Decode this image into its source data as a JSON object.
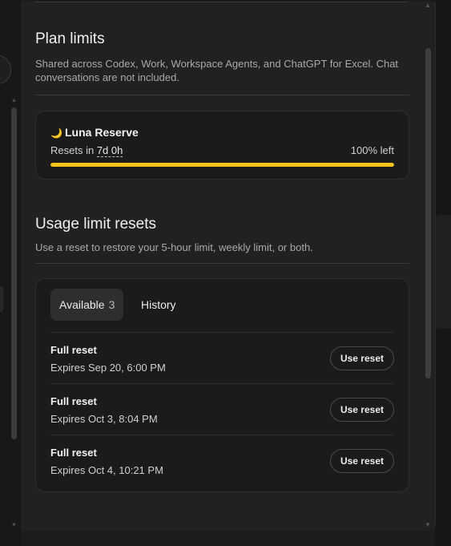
{
  "plan_limits": {
    "title": "Plan limits",
    "description": "Shared across Codex, Work, Workspace Agents, and ChatGPT for Excel. Chat conversations are not included.",
    "plan": {
      "icon": "moon-icon",
      "name": "Luna Reserve",
      "resets_prefix": "Resets in",
      "resets_time": "7d 0h",
      "left_label": "100% left",
      "progress_fraction": 1.0,
      "accent_color": "#f2c318"
    }
  },
  "usage_resets": {
    "title": "Usage limit resets",
    "description": "Use a reset to restore your 5-hour limit, weekly limit, or both.",
    "tabs": [
      {
        "label": "Available",
        "count": "3",
        "active": true
      },
      {
        "label": "History",
        "active": false
      }
    ],
    "items": [
      {
        "title": "Full reset",
        "expires": "Expires Sep 20, 6:00 PM",
        "button": "Use reset"
      },
      {
        "title": "Full reset",
        "expires": "Expires Oct 3, 8:04 PM",
        "button": "Use reset"
      },
      {
        "title": "Full reset",
        "expires": "Expires Oct 4, 10:21 PM",
        "button": "Use reset"
      }
    ]
  }
}
